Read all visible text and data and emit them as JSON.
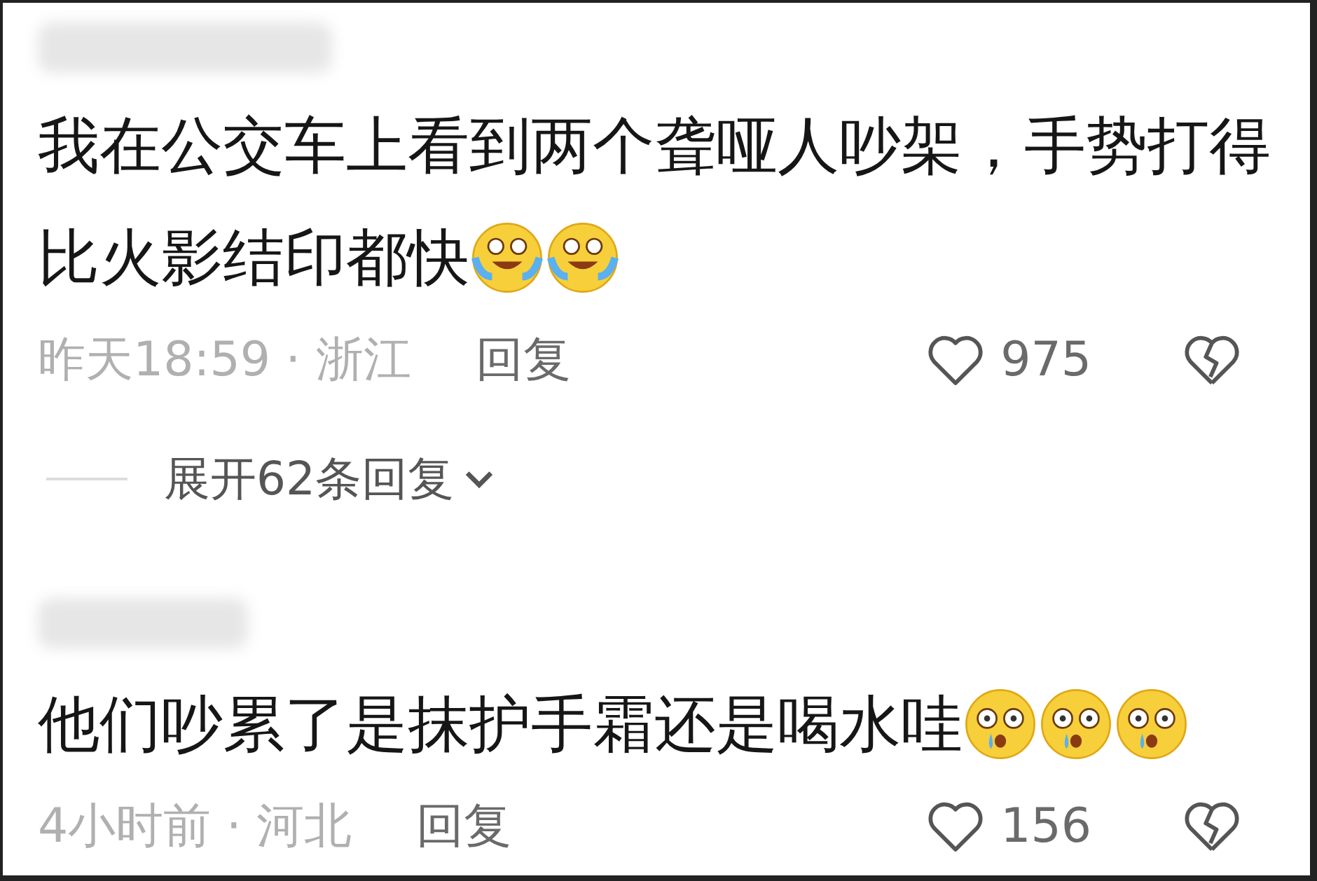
{
  "comments": [
    {
      "text": "我在公交车上看到两个聋哑人吵架，手势打得比火影结印都快",
      "emojis": [
        {
          "kind": "crying"
        },
        {
          "kind": "crying"
        }
      ],
      "time": "昨天18:59 · 浙江",
      "reply": "回复",
      "likes": "975",
      "expand": "展开62条回复"
    },
    {
      "text": "他们吵累了是抹护手霜还是喝水哇",
      "emojis": [
        {
          "kind": "drooling"
        },
        {
          "kind": "drooling"
        },
        {
          "kind": "drooling"
        }
      ],
      "time": "4小时前 · 河北",
      "reply": "回复",
      "likes": "156"
    }
  ]
}
